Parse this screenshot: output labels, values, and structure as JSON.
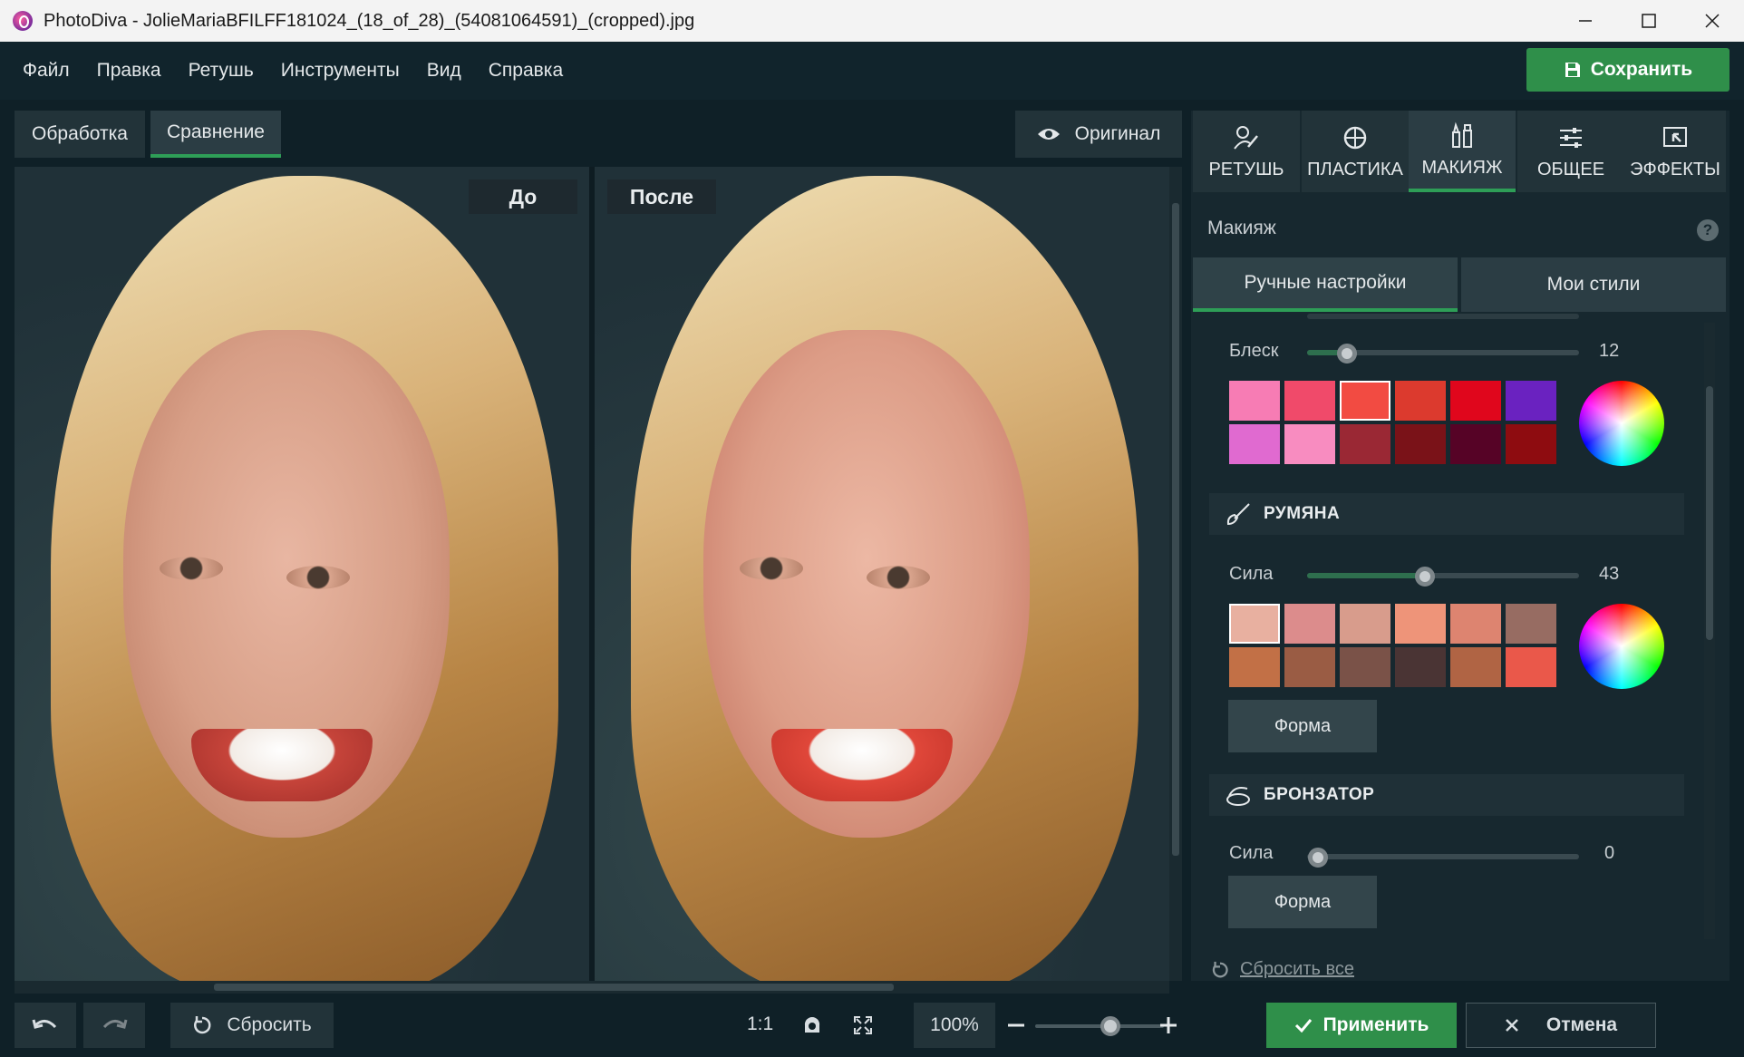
{
  "window": {
    "title": "PhotoDiva - JolieMariaBFILFF181024_(18_of_28)_(54081064591)_(cropped).jpg"
  },
  "menu": [
    "Файл",
    "Правка",
    "Ретушь",
    "Инструменты",
    "Вид",
    "Справка"
  ],
  "save_label": "Сохранить",
  "toolbar": {
    "process_tab": "Обработка",
    "compare_tab": "Сравнение",
    "original_label": "Оригинал"
  },
  "compare": {
    "before_label": "До",
    "after_label": "После"
  },
  "bottom": {
    "reset_label": "Сбросить",
    "ratio_label": "1:1",
    "zoom_value": "100%"
  },
  "right_tabs": [
    {
      "label": "РЕТУШЬ",
      "icon": "retouch-icon"
    },
    {
      "label": "ПЛАСТИКА",
      "icon": "plastic-icon"
    },
    {
      "label": "МАКИЯЖ",
      "icon": "makeup-icon"
    },
    {
      "label": "ОБЩЕЕ",
      "icon": "sliders-icon"
    },
    {
      "label": "ЭФФЕКТЫ",
      "icon": "effects-icon"
    }
  ],
  "panel": {
    "title": "Макияж",
    "help": "?",
    "subtabs": [
      "Ручные настройки",
      "Мои стили"
    ],
    "gloss": {
      "label": "Блеск",
      "value": "12",
      "swatches": [
        "#f77cb4",
        "#f04a6a",
        "#f24b42",
        "#dc3a2e",
        "#e0061c",
        "#6a22c0",
        "#e06ad0",
        "#f88cc0",
        "#9a2834",
        "#7a1218",
        "#560326",
        "#8e0c10"
      ],
      "selected_index": 2
    },
    "blush": {
      "title": "РУМЯНА",
      "label": "Сила",
      "value": "43",
      "form_label": "Форма",
      "swatches": [
        "#e8b0a0",
        "#dc8c8c",
        "#d89c8c",
        "#ee9479",
        "#dd8470",
        "#976c62",
        "#c27046",
        "#9a5c44",
        "#7a5248",
        "#4a3434",
        "#b06444",
        "#ea584a"
      ],
      "selected_index": 0
    },
    "bronzer": {
      "title": "БРОНЗАТОР",
      "label": "Сила",
      "value": "0",
      "form_label": "Форма"
    },
    "reset_all": "Сбросить все"
  },
  "apply_label": "Применить",
  "cancel_label": "Отмена",
  "colors": {
    "accent": "#2f8f4a",
    "bg": "#0f2027",
    "panel": "#17282f"
  }
}
